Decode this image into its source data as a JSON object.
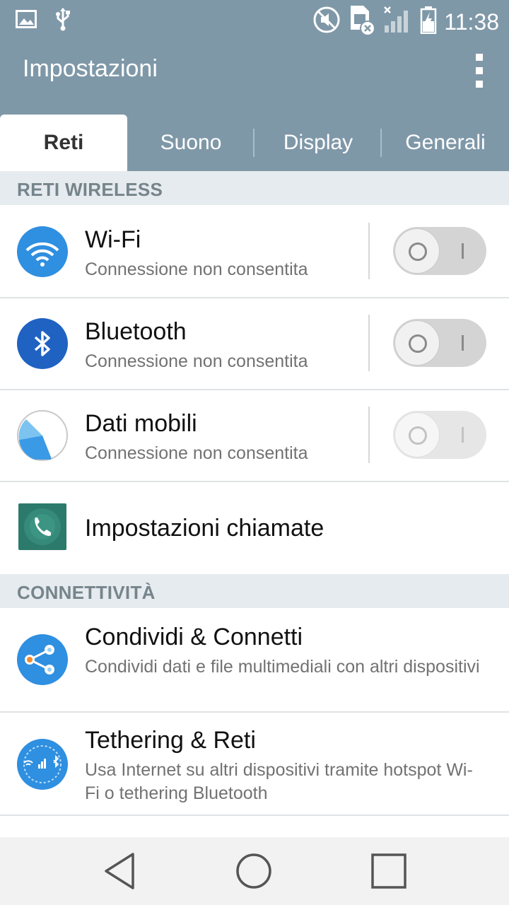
{
  "status_bar": {
    "time": "11:38",
    "icons": [
      "gallery-icon",
      "usb-icon",
      "mute-icon",
      "sim-error-icon",
      "signal-icon",
      "battery-charging-icon"
    ]
  },
  "app_bar": {
    "title": "Impostazioni",
    "overflow_icon": "more-vert-icon"
  },
  "tabs": [
    {
      "label": "Reti",
      "active": true
    },
    {
      "label": "Suono",
      "active": false
    },
    {
      "label": "Display",
      "active": false
    },
    {
      "label": "Generali",
      "active": false
    }
  ],
  "sections": {
    "wireless": "RETI WIRELESS",
    "connectivity": "CONNETTIVITÀ"
  },
  "items": {
    "wifi": {
      "title": "Wi-Fi",
      "subtitle": "Connessione non consentita",
      "icon": "wifi-icon",
      "enabled": false
    },
    "bluetooth": {
      "title": "Bluetooth",
      "subtitle": "Connessione non consentita",
      "icon": "bluetooth-icon",
      "enabled": false
    },
    "mobile_data": {
      "title": "Dati mobili",
      "subtitle": "Connessione non consentita",
      "icon": "mobile-data-icon",
      "enabled": false
    },
    "call_settings": {
      "title": "Impostazioni chiamate",
      "icon": "phone-icon"
    },
    "share_connect": {
      "title": "Condividi & Connetti",
      "subtitle": "Condividi dati e file multimediali con altri dispositivi",
      "icon": "share-icon"
    },
    "tethering": {
      "title": "Tethering & Reti",
      "subtitle": "Usa Internet su altri dispositivi tramite hotspot Wi-Fi o tethering Bluetooth",
      "icon": "tethering-icon"
    }
  },
  "nav_bar": {
    "back": "back-icon",
    "home": "home-icon",
    "recents": "recents-icon"
  },
  "colors": {
    "header": "#7f98a8",
    "section_bg": "#e5ebee",
    "icon_blue": "#2f8fe0"
  }
}
